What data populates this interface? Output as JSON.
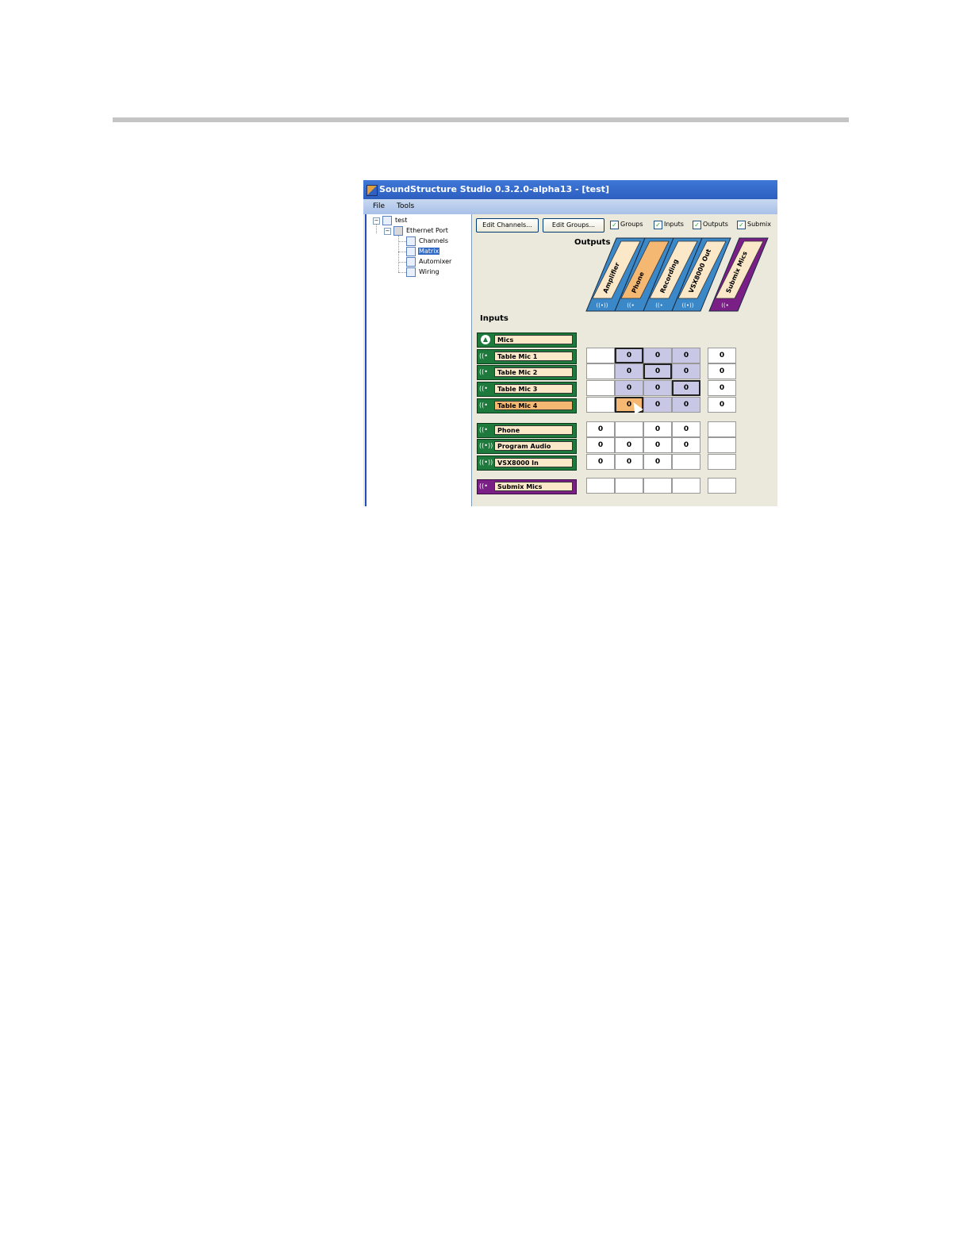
{
  "window": {
    "title": "SoundStructure Studio 0.3.2.0-alpha13 - [test]"
  },
  "menu": [
    "File",
    "Tools"
  ],
  "tree": {
    "root": "test",
    "port": "Ethernet Port",
    "items": [
      "Channels",
      "Matrix",
      "Automixer",
      "Wiring"
    ],
    "selected": "Matrix"
  },
  "toolbar": {
    "edit_channels": "Edit Channels...",
    "edit_groups": "Edit Groups...",
    "checkboxes": [
      {
        "label": "Groups",
        "checked": true
      },
      {
        "label": "Inputs",
        "checked": true
      },
      {
        "label": "Outputs",
        "checked": true
      },
      {
        "label": "Submix",
        "checked": true
      }
    ]
  },
  "labels": {
    "outputs": "Outputs",
    "inputs": "Inputs"
  },
  "outputs": [
    {
      "label": "Amplifier",
      "icon": "((•))",
      "highlight": false,
      "color": "#3a88c8"
    },
    {
      "label": "Phone",
      "icon": "((•",
      "highlight": true,
      "color": "#3a88c8"
    },
    {
      "label": "Recording",
      "icon": "((•",
      "highlight": false,
      "color": "#3a88c8"
    },
    {
      "label": "VSX8000 Out",
      "icon": "((•))",
      "highlight": false,
      "color": "#3a88c8"
    },
    {
      "label": "Submix Mics",
      "icon": "((•",
      "highlight": false,
      "color": "#7a1f86"
    }
  ],
  "inputs": [
    {
      "label": "Mics",
      "icon": "group-icon",
      "type": "group",
      "highlight": false,
      "cells": null
    },
    {
      "label": "Table Mic 1",
      "icon": "((•",
      "type": "input",
      "highlight": false,
      "cells": [
        [
          "",
          "plain"
        ],
        [
          "0",
          "sh bx"
        ],
        [
          "0",
          "sh"
        ],
        [
          "0",
          "sh"
        ],
        [
          "0",
          "plain"
        ]
      ]
    },
    {
      "label": "Table Mic 2",
      "icon": "((•",
      "type": "input",
      "highlight": false,
      "cells": [
        [
          "",
          "plain"
        ],
        [
          "0",
          "sh"
        ],
        [
          "0",
          "sh bx"
        ],
        [
          "0",
          "sh"
        ],
        [
          "0",
          "plain"
        ]
      ]
    },
    {
      "label": "Table Mic 3",
      "icon": "((•",
      "type": "input",
      "highlight": false,
      "cells": [
        [
          "",
          "plain"
        ],
        [
          "0",
          "sh"
        ],
        [
          "0",
          "sh"
        ],
        [
          "0",
          "sh bx"
        ],
        [
          "0",
          "plain"
        ]
      ]
    },
    {
      "label": "Table Mic 4",
      "icon": "((•",
      "type": "input",
      "highlight": true,
      "cells": [
        [
          "",
          "plain"
        ],
        [
          "0",
          "or bx"
        ],
        [
          "0",
          "sh"
        ],
        [
          "0",
          "sh"
        ],
        [
          "0",
          "plain"
        ]
      ]
    },
    {
      "label": "Phone",
      "icon": "((•",
      "type": "input",
      "highlight": false,
      "cells": [
        [
          "0",
          "plain"
        ],
        [
          "",
          "plain"
        ],
        [
          "0",
          "plain"
        ],
        [
          "0",
          "plain"
        ],
        [
          "",
          "plain"
        ]
      ]
    },
    {
      "label": "Program Audio",
      "icon": "((•))",
      "type": "input",
      "highlight": false,
      "cells": [
        [
          "0",
          "plain"
        ],
        [
          "0",
          "plain"
        ],
        [
          "0",
          "plain"
        ],
        [
          "0",
          "plain"
        ],
        [
          "",
          "plain"
        ]
      ]
    },
    {
      "label": "VSX8000 In",
      "icon": "((•))",
      "type": "input",
      "highlight": false,
      "cells": [
        [
          "0",
          "plain"
        ],
        [
          "0",
          "plain"
        ],
        [
          "0",
          "plain"
        ],
        [
          "",
          "plain"
        ],
        [
          "",
          "plain"
        ]
      ]
    },
    {
      "label": "Submix Mics",
      "icon": "((•",
      "type": "submix",
      "highlight": false,
      "cells": [
        [
          "",
          "plain"
        ],
        [
          "",
          "plain"
        ],
        [
          "",
          "plain"
        ],
        [
          "",
          "plain"
        ],
        [
          "",
          "plain"
        ]
      ]
    }
  ]
}
